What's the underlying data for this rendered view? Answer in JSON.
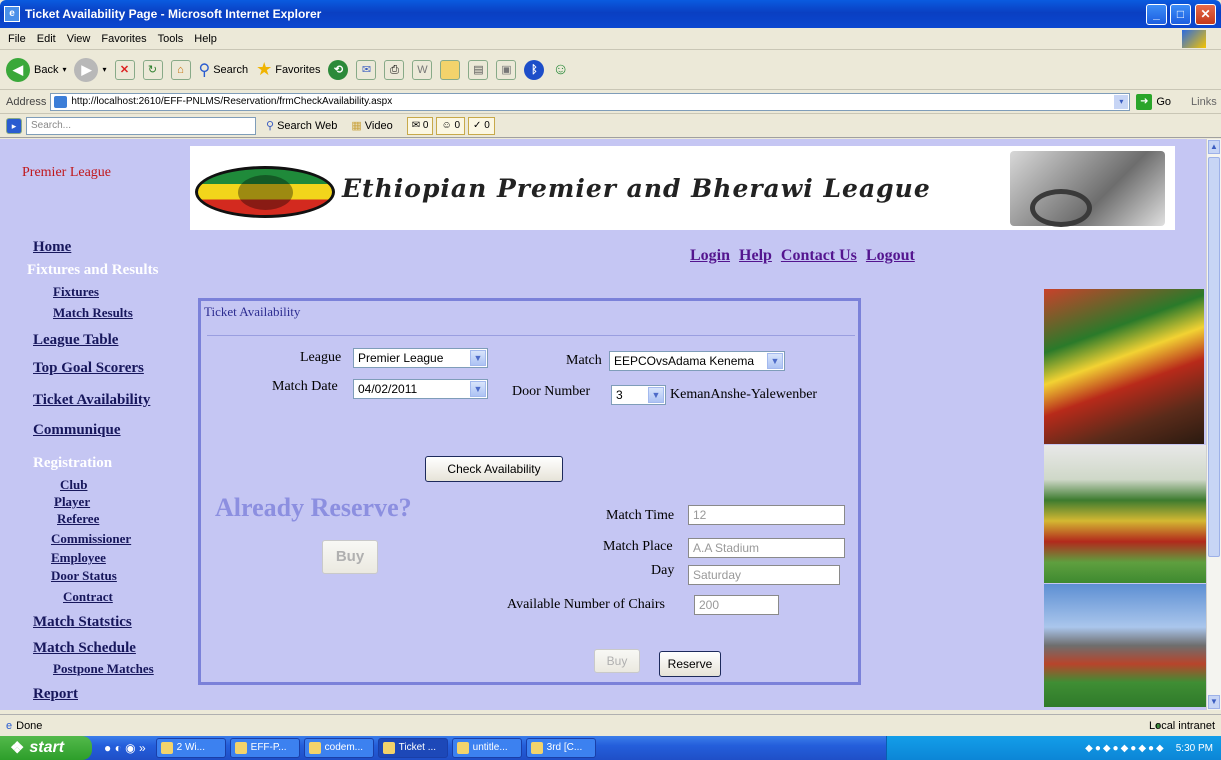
{
  "window": {
    "title": "Ticket Availability Page - Microsoft Internet Explorer"
  },
  "menu": [
    "File",
    "Edit",
    "View",
    "Favorites",
    "Tools",
    "Help"
  ],
  "toolbar": {
    "back": "Back",
    "search": "Search",
    "favorites": "Favorites"
  },
  "address": {
    "label": "Address",
    "url": "http://localhost:2610/EFF-PNLMS/Reservation/frmCheckAvailability.aspx",
    "go": "Go",
    "links": "Links"
  },
  "searchbar": {
    "placeholder": "Search...",
    "search_web": "Search Web",
    "video": "Video",
    "count1": "0",
    "count2": "0",
    "count3": "0"
  },
  "page": {
    "side_brand": "Premier League",
    "banner_title": "Ethiopian Premier and Bherawi League",
    "toplinks": [
      "Login",
      "Help",
      "Contact Us",
      "Logout"
    ],
    "nav": {
      "home": "Home",
      "fixtures_results": "Fixtures and Results",
      "fixtures": "Fixtures",
      "match_results": "Match Results",
      "league_table": "League Table",
      "top_goal_scorers": "Top Goal Scorers",
      "ticket_availability": "Ticket Availability",
      "communique": "Communique",
      "registration": "Registration",
      "club": "Club",
      "player": "Player",
      "referee": "Referee",
      "commissioner": "Commissioner",
      "employee": "Employee",
      "door_status": "Door Status",
      "contract": "Contract",
      "match_statstics": "Match Statstics",
      "match_schedule": "Match Schedule",
      "postpone_matches": "Postpone Matches",
      "report": "Report"
    },
    "panel": {
      "title": "Ticket Availability",
      "league_label": "League",
      "league_value": "Premier League",
      "match_label": "Match",
      "match_value": "EEPCOvsAdama Kenema",
      "date_label": "Match Date",
      "date_value": "04/02/2011",
      "door_label": "Door Number",
      "door_value": "3",
      "door_name": "KemanAnshe-Yalewenber",
      "check_button": "Check Availability",
      "already": "Already Reserve?",
      "buy_big": "Buy",
      "time_label": "Match Time",
      "time_value": "12",
      "place_label": "Match Place",
      "place_value": "A.A Stadium",
      "day_label": "Day",
      "day_value": "Saturday",
      "chairs_label": "Available Number of Chairs",
      "chairs_value": "200",
      "buy_small": "Buy",
      "reserve": "Reserve"
    }
  },
  "status": {
    "text": "Done",
    "zone": "Local intranet"
  },
  "taskbar": {
    "start": "start",
    "tasks": [
      "2 Wi...",
      "EFF-P...",
      "codem...",
      "Ticket ...",
      "untitle...",
      "3rd [C..."
    ],
    "clock": "5:30 PM"
  }
}
